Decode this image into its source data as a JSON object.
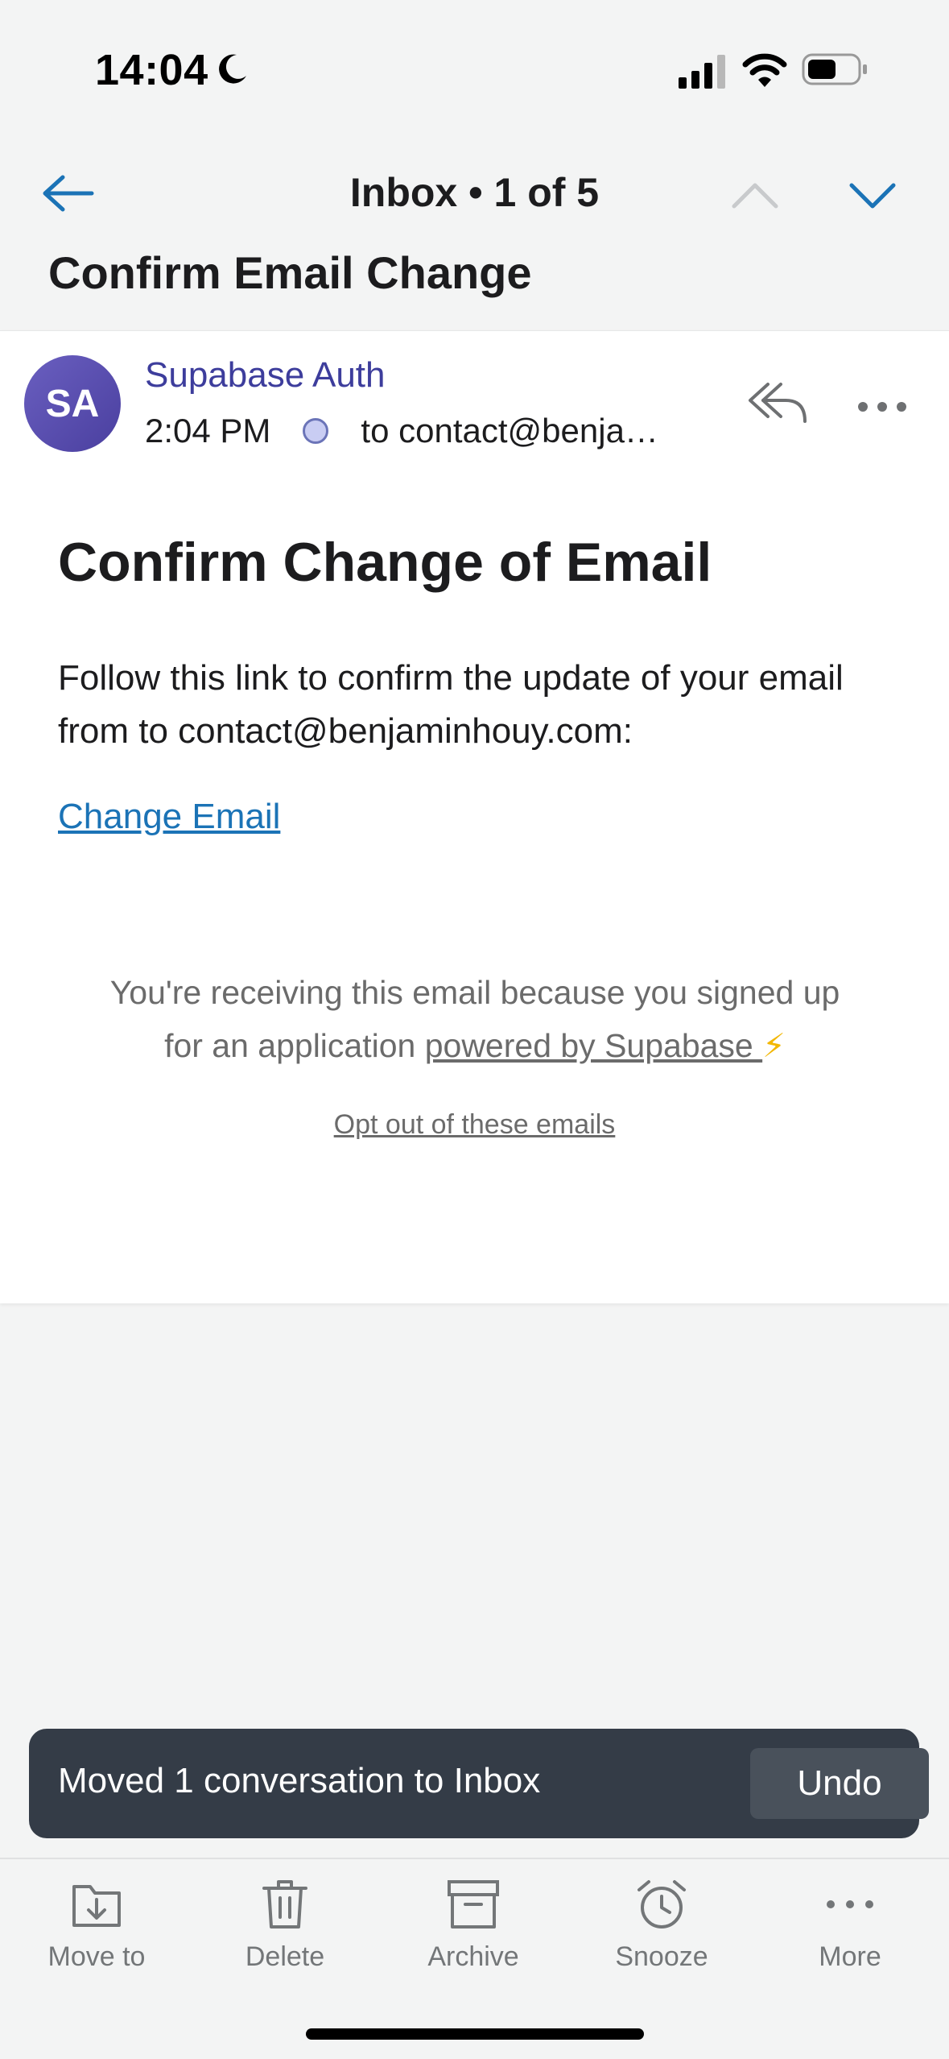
{
  "status_bar": {
    "time": "14:04"
  },
  "nav": {
    "title": "Inbox • 1 of 5"
  },
  "email": {
    "subject": "Confirm Email Change",
    "avatar_initials": "SA",
    "sender": "Supabase Auth",
    "time": "2:04 PM",
    "recipient": "to contact@benja…",
    "heading": "Confirm Change of Email",
    "body": "Follow this link to confirm the update of your email from to contact@benjaminhouy.com:",
    "link_label": "Change Email",
    "footer_prefix": "You're receiving this email because you signed up for an application ",
    "footer_link": "powered by Supabase ",
    "footer_bolt": "⚡",
    "optout_label": "Opt out of these emails"
  },
  "toast": {
    "message": "Moved 1 conversation to Inbox",
    "undo_label": "Undo"
  },
  "toolbar": {
    "move_to": "Move to",
    "delete": "Delete",
    "archive": "Archive",
    "snooze": "Snooze",
    "more": "More"
  },
  "colors": {
    "accent_blue": "#1b73b6",
    "sender_purple": "#3d3d9c",
    "toast_bg": "#343c47"
  }
}
